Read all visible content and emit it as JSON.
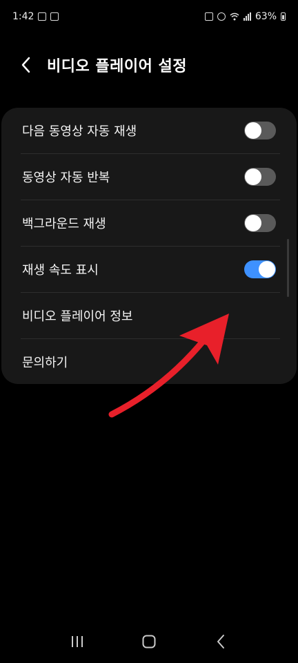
{
  "status_bar": {
    "time": "1:42",
    "battery_percent": "63%",
    "icons_left": [
      "gallery-icon",
      "alarm-dx-icon"
    ],
    "icons_right": [
      "lock-icon",
      "alarm-icon",
      "wifi-icon",
      "signal-icon",
      "battery-icon"
    ]
  },
  "header": {
    "back_icon": "chevron-left-icon",
    "title": "비디오 플레이어 설정"
  },
  "settings": {
    "items": [
      {
        "label": "다음 동영상 자동 재생",
        "toggle": "off"
      },
      {
        "label": "동영상 자동 반복",
        "toggle": "off"
      },
      {
        "label": "백그라운드 재생",
        "toggle": "off"
      },
      {
        "label": "재생 속도 표시",
        "toggle": "on"
      },
      {
        "label": "비디오 플레이어 정보"
      },
      {
        "label": "문의하기"
      }
    ]
  },
  "colors": {
    "background": "#000000",
    "card": "#181818",
    "toggle_on": "#3e91ff",
    "toggle_off": "#5a5a5a",
    "annotation_arrow": "#e8202a"
  },
  "nav_bar": {
    "recent_icon": "recent-apps-icon",
    "home_icon": "home-icon",
    "back_icon": "back-icon"
  }
}
